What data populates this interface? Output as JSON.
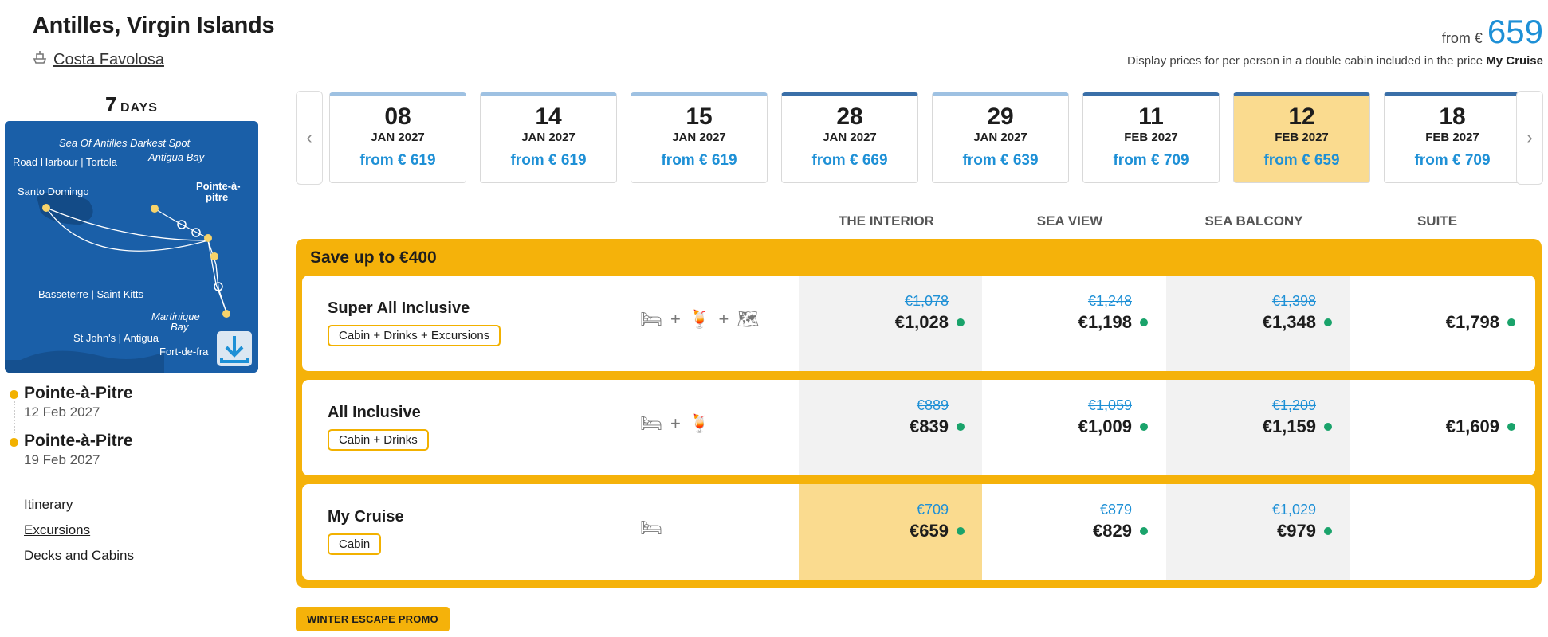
{
  "header": {
    "title": "Antilles, Virgin Islands",
    "ship_name": "Costa Favolosa",
    "price_from_label": "from €",
    "price_from_value": "659",
    "disclaimer_text": "Display prices for per person in a double cabin included in the price",
    "disclaimer_bold": "My Cruise"
  },
  "duration": {
    "number": "7",
    "label": "DAYS"
  },
  "map": {
    "labels": [
      "Sea Of Antilles Darkest Spot",
      "Road Harbour | Tortola",
      "Antigua Bay",
      "Pointe-à-",
      "pitre",
      "Santo Domingo",
      "Basseterre | Saint Kitts",
      "Martinique",
      "Bay",
      "St John's | Antigua",
      "Fort-de-fra"
    ]
  },
  "stops": [
    {
      "port": "Pointe-à-Pitre",
      "date": "12 Feb 2027"
    },
    {
      "port": "Pointe-à-Pitre",
      "date": "19 Feb 2027"
    }
  ],
  "links": [
    "Itinerary",
    "Excursions",
    "Decks and Cabins"
  ],
  "dates": [
    {
      "day": "08",
      "month": "JAN 2027",
      "price": "from € 619",
      "style": "light"
    },
    {
      "day": "14",
      "month": "JAN 2027",
      "price": "from € 619",
      "style": "light"
    },
    {
      "day": "15",
      "month": "JAN 2027",
      "price": "from € 619",
      "style": "light"
    },
    {
      "day": "28",
      "month": "JAN 2027",
      "price": "from € 669",
      "style": "dark"
    },
    {
      "day": "29",
      "month": "JAN 2027",
      "price": "from € 639",
      "style": "light"
    },
    {
      "day": "11",
      "month": "FEB 2027",
      "price": "from € 709",
      "style": "dark"
    },
    {
      "day": "12",
      "month": "FEB 2027",
      "price": "from € 659",
      "style": "active"
    },
    {
      "day": "18",
      "month": "FEB 2027",
      "price": "from € 709",
      "style": "dark"
    }
  ],
  "cabins": [
    "THE INTERIOR",
    "SEA VIEW",
    "SEA BALCONY",
    "SUITE"
  ],
  "offer": {
    "save_label": "Save up to €400",
    "rows": [
      {
        "name": "Super All Inclusive",
        "tag": "Cabin + Drinks + Excursions",
        "icons": "🛏 + 🍹 + 🗺",
        "prices": [
          {
            "old": "€1,078",
            "new": "€1,028"
          },
          {
            "old": "€1,248",
            "new": "€1,198"
          },
          {
            "old": "€1,398",
            "new": "€1,348"
          },
          {
            "old": "",
            "new": "€1,798"
          }
        ]
      },
      {
        "name": "All Inclusive",
        "tag": "Cabin + Drinks",
        "icons": "🛏 + 🍹",
        "prices": [
          {
            "old": "€889",
            "new": "€839"
          },
          {
            "old": "€1,059",
            "new": "€1,009"
          },
          {
            "old": "€1,209",
            "new": "€1,159"
          },
          {
            "old": "",
            "new": "€1,609"
          }
        ]
      },
      {
        "name": "My Cruise",
        "tag": "Cabin",
        "icons": "🛏",
        "prices": [
          {
            "old": "€709",
            "new": "€659"
          },
          {
            "old": "€879",
            "new": "€829"
          },
          {
            "old": "€1,029",
            "new": "€979"
          },
          {
            "old": "",
            "new": ""
          }
        ]
      }
    ]
  },
  "promo_label": "WINTER ESCAPE PROMO",
  "colors": {
    "accent": "#f5b20a",
    "link_blue": "#1e90d6",
    "available_green": "#1aa36b",
    "selected_bg": "#fadb8f"
  }
}
